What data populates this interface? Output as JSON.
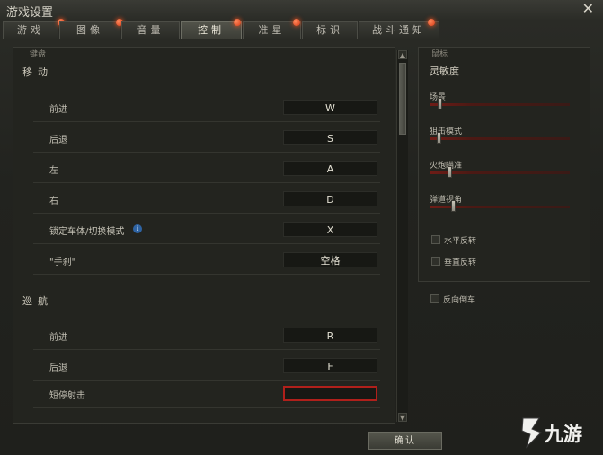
{
  "window": {
    "title": "游戏设置",
    "close_glyph": "✕"
  },
  "tabs": [
    {
      "label": "游戏",
      "active": false
    },
    {
      "label": "图像",
      "active": false
    },
    {
      "label": "音量",
      "active": false
    },
    {
      "label": "控制",
      "active": true
    },
    {
      "label": "准星",
      "active": false
    },
    {
      "label": "标识",
      "active": false
    },
    {
      "label": "战斗通知",
      "active": false
    }
  ],
  "keyboard": {
    "panel_label": "键盘",
    "sections": [
      {
        "title": "移动",
        "rows": [
          {
            "label": "前进",
            "key": "W"
          },
          {
            "label": "后退",
            "key": "S"
          },
          {
            "label": "左",
            "key": "A"
          },
          {
            "label": "右",
            "key": "D"
          },
          {
            "label": "锁定车体/切换模式",
            "key": "X",
            "info": "i"
          },
          {
            "label": "\"手刹\"",
            "key": "空格"
          }
        ]
      },
      {
        "title": "巡航",
        "rows": [
          {
            "label": "前进",
            "key": "R"
          },
          {
            "label": "后退",
            "key": "F"
          },
          {
            "label": "短停射击",
            "key": "",
            "active": true
          }
        ]
      }
    ]
  },
  "mouse": {
    "panel_label": "鼠标",
    "sensitivity_title": "灵敏度",
    "sliders": [
      {
        "label": "场景",
        "value": 0.06
      },
      {
        "label": "狙击模式",
        "value": 0.05
      },
      {
        "label": "火炮瞄准",
        "value": 0.13
      },
      {
        "label": "弹道视角",
        "value": 0.16
      }
    ],
    "checkboxes": [
      {
        "label": "水平反转",
        "checked": false
      },
      {
        "label": "垂直反转",
        "checked": false
      }
    ]
  },
  "extra_checkbox": {
    "label": "反向倒车",
    "checked": false
  },
  "buttons": {
    "confirm": "确认"
  },
  "watermark": {
    "text": "九游"
  },
  "colors": {
    "accent_red": "#b0201b",
    "tab_dot": "#e0502a"
  }
}
